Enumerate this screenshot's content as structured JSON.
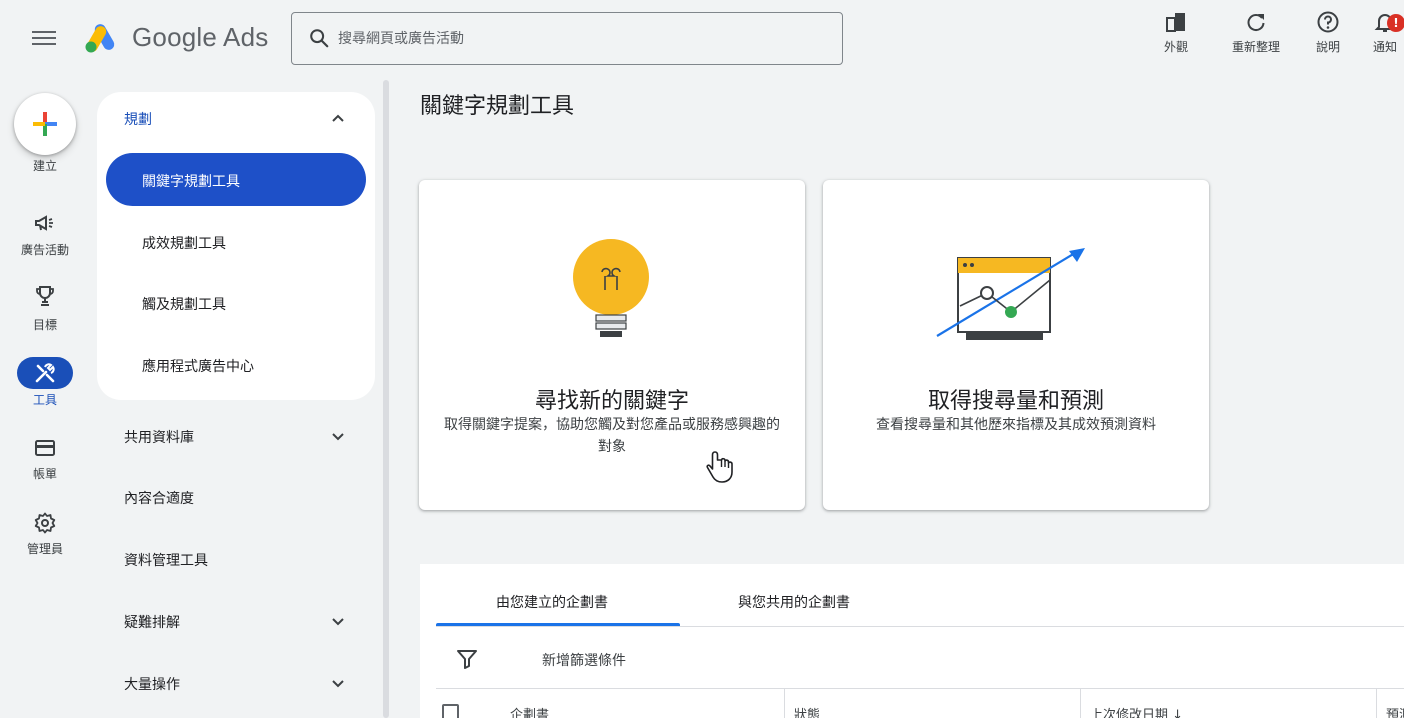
{
  "header": {
    "brand": "Google Ads",
    "search_placeholder": "搜尋網頁或廣告活動",
    "tools": {
      "appearance": "外觀",
      "refresh": "重新整理",
      "help": "說明",
      "notifications": "通知"
    },
    "notification_badge": "!"
  },
  "rail": {
    "create": "建立",
    "campaigns": "廣告活動",
    "goals": "目標",
    "tools": "工具",
    "billing": "帳單",
    "admin": "管理員"
  },
  "nav": {
    "planning_section": "規劃",
    "planning_items": {
      "keyword_planner": "關鍵字規劃工具",
      "performance_planner": "成效規劃工具",
      "reach_planner": "觸及規劃工具",
      "app_ads_hub": "應用程式廣告中心"
    },
    "shared_library": "共用資料庫",
    "content_suitability": "內容合適度",
    "data_manager": "資料管理工具",
    "troubleshooting": "疑難排解",
    "bulk_actions": "大量操作"
  },
  "main": {
    "page_title": "關鍵字規劃工具",
    "card_discover": {
      "title": "尋找新的關鍵字",
      "desc": "取得關鍵字提案，協助您觸及對您產品或服務感興趣的對象"
    },
    "card_forecast": {
      "title": "取得搜尋量和預測",
      "desc": "查看搜尋量和其他歷來指標及其成效預測資料"
    },
    "tabs": {
      "created_by_you": "由您建立的企劃書",
      "shared_with_you": "與您共用的企劃書"
    },
    "add_filter": "新增篩選條件",
    "columns": {
      "plan": "企劃書",
      "status": "狀態",
      "last_modified": "上次修改日期 ↓",
      "forecast": "預測"
    }
  },
  "colors": {
    "accent": "#1a4fb8",
    "active_nav": "#1e50c8",
    "tab_underline": "#1a73e8",
    "background": "#f1f3f4",
    "bulb": "#f6b822",
    "chart_accent": "#1a73e8",
    "chart_point": "#34a853"
  }
}
